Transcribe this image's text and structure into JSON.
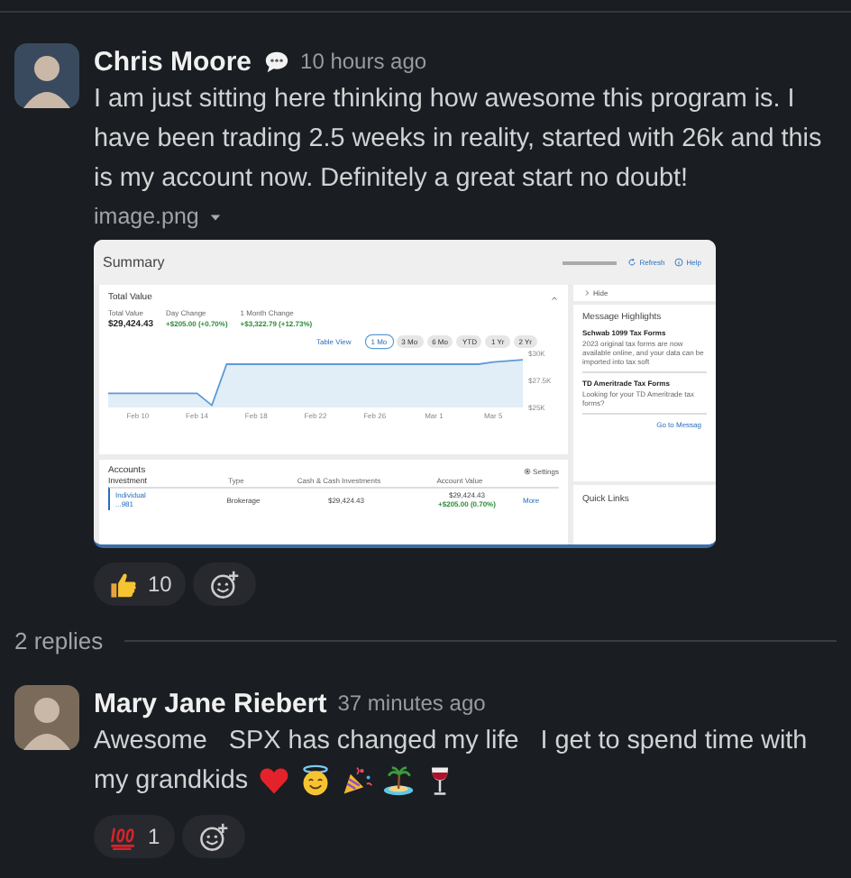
{
  "messages": [
    {
      "author": "Chris Moore",
      "status_bubble": true,
      "time": "10 hours ago",
      "lines": [
        "I am just sitting here thinking how awesome this program is. I have been trading 2.5 weeks in reality, started with 26k and this is my account now. Definitely a great start no doubt!"
      ],
      "attachment": {
        "filename": "image.png",
        "screenshot": {
          "title": "Summary",
          "refresh": "Refresh",
          "help": "Help",
          "panel_title": "Total Value",
          "stats": [
            {
              "label": "Total Value",
              "value": "$29,424.43",
              "positive": false
            },
            {
              "label": "Day Change",
              "value": "+$205.00 (+0.70%)",
              "positive": true
            },
            {
              "label": "1 Month Change",
              "value": "+$3,322.79 (+12.73%)",
              "positive": true
            }
          ],
          "table_view": "Table View",
          "ranges": [
            {
              "label": "1 Mo",
              "selected": true
            },
            {
              "label": "3 Mo",
              "selected": false
            },
            {
              "label": "6 Mo",
              "selected": false
            },
            {
              "label": "YTD",
              "selected": false
            },
            {
              "label": "1 Yr",
              "selected": false
            },
            {
              "label": "2 Yr",
              "selected": false
            }
          ],
          "chart_data": {
            "type": "area",
            "categories": [
              null,
              null,
              "Feb 10",
              null,
              null,
              null,
              "Feb 14",
              null,
              null,
              null,
              "Feb 18",
              null,
              null,
              null,
              "Feb 22",
              null,
              null,
              null,
              "Feb 26",
              null,
              null,
              null,
              "Mar 1",
              null,
              null,
              null,
              "Mar 5",
              null,
              null
            ],
            "series": [
              {
                "color": "#5b9bd5",
                "values": [
                  26300,
                  26300,
                  26300,
                  26300,
                  26300,
                  26300,
                  26300,
                  25200,
                  29000,
                  29000,
                  29000,
                  29000,
                  29000,
                  29000,
                  29000,
                  29000,
                  29000,
                  29000,
                  29000,
                  29000,
                  29000,
                  29000,
                  29000,
                  29000,
                  29000,
                  29000,
                  29200,
                  29300,
                  29400
                ]
              }
            ],
            "ylim": [
              25000,
              30000
            ],
            "yticks": [
              {
                "value": 30000,
                "label": "$30K"
              },
              {
                "value": 27500,
                "label": "$27.5K"
              },
              {
                "value": 25000,
                "label": "$25K"
              }
            ]
          },
          "hide": "Hide",
          "highlights_title": "Message Highlights",
          "highlights": [
            {
              "title": "Schwab 1099 Tax Forms",
              "text": "2023 original tax forms are now available online, and your data can be imported into tax soft"
            },
            {
              "title": "TD Ameritrade Tax Forms",
              "text": "Looking for your TD Ameritrade tax forms?"
            }
          ],
          "go_link": "Go to Messag",
          "quick_links": "Quick Links",
          "accounts_title": "Accounts",
          "settings": "Settings",
          "columns": [
            "Investment",
            "Type",
            "Cash & Cash Investments",
            "Account Value"
          ],
          "row": {
            "name": "Individual",
            "number": "...981",
            "type": "Brokerage",
            "cash": "$29,424.43",
            "value": "$29,424.43",
            "change": "+$205.00 (0.70%)",
            "more": "More"
          }
        }
      },
      "reactions": [
        {
          "kind": "thumbs-up",
          "count": "10"
        }
      ]
    },
    {
      "author": "Mary Jane Riebert",
      "status_bubble": false,
      "time": "37 minutes ago",
      "lines": [
        "Awesome   SPX has changed my life   I get to spend time with",
        "my grandkids"
      ],
      "emojis": [
        {
          "kind": "heart"
        },
        {
          "kind": "halo"
        },
        {
          "kind": "party"
        },
        {
          "kind": "island"
        },
        {
          "kind": "wine"
        }
      ],
      "reactions": [
        {
          "kind": "hundred",
          "count": "1"
        }
      ]
    }
  ],
  "replies_label": "2 replies"
}
